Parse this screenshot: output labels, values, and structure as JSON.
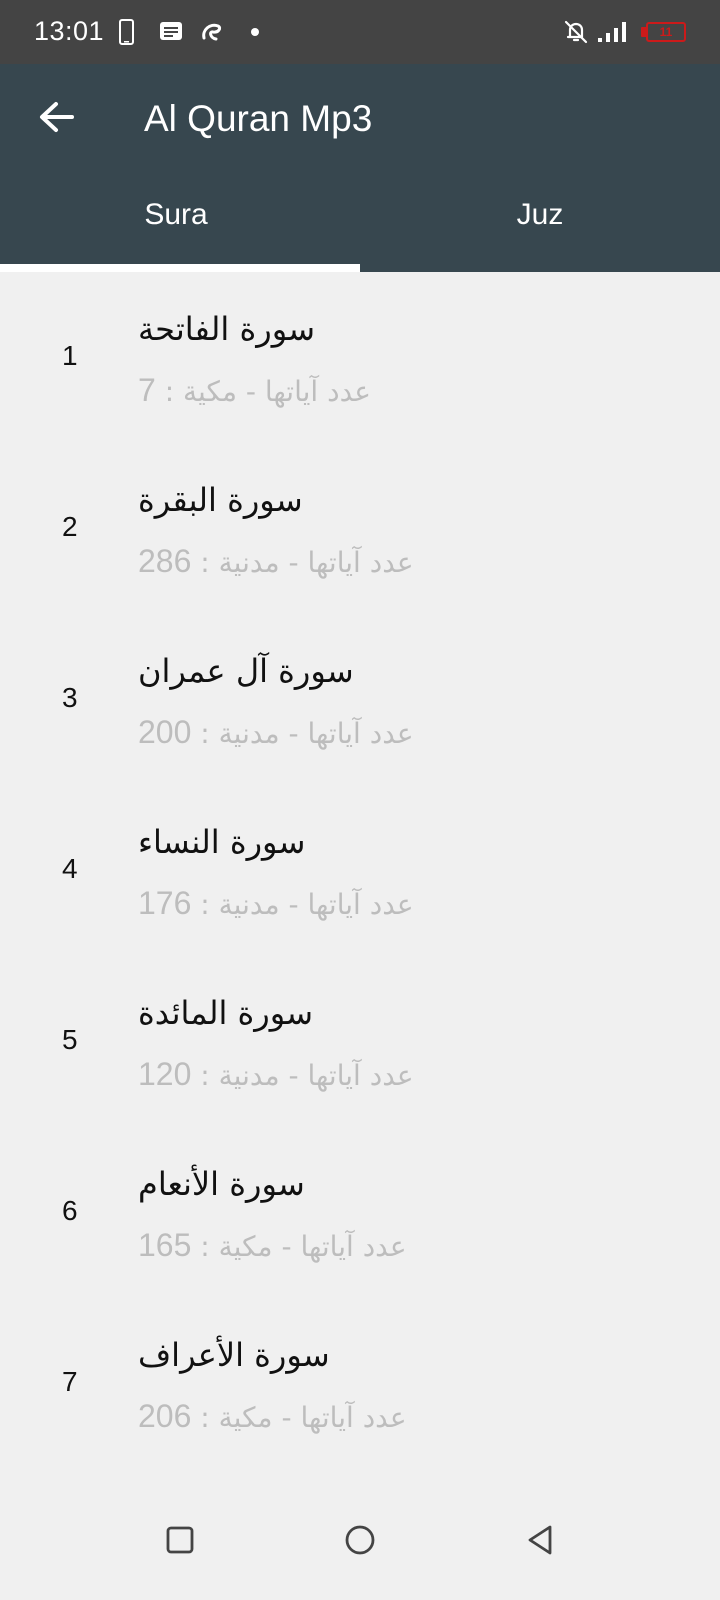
{
  "status_bar": {
    "time": "13:01",
    "battery_label": "11",
    "icons": [
      "phone-outline-icon",
      "message-icon",
      "swirl-app-icon",
      "dot-icon",
      "bell-off-icon",
      "signal-icon",
      "battery-low-icon"
    ],
    "battery_color": "#cc1a1a"
  },
  "app_bar": {
    "title": "Al Quran Mp3",
    "back_icon": "arrow-back-icon",
    "background_color": "#37474f"
  },
  "tabs": [
    {
      "label": "Sura",
      "selected": true
    },
    {
      "label": "Juz",
      "selected": false
    }
  ],
  "suras": [
    {
      "number": "1",
      "name": "سورة الفاتحة",
      "type": "مكية",
      "count_label": "عدد آياتها",
      "count": "7"
    },
    {
      "number": "2",
      "name": "سورة البقرة",
      "type": "مدنية",
      "count_label": "عدد آياتها",
      "count": "286"
    },
    {
      "number": "3",
      "name": "سورة آل عمران",
      "type": "مدنية",
      "count_label": "عدد آياتها",
      "count": "200"
    },
    {
      "number": "4",
      "name": "سورة النساء",
      "type": "مدنية",
      "count_label": "عدد آياتها",
      "count": "176"
    },
    {
      "number": "5",
      "name": "سورة المائدة",
      "type": "مدنية",
      "count_label": "عدد آياتها",
      "count": "120"
    },
    {
      "number": "6",
      "name": "سورة الأنعام",
      "type": "مكية",
      "count_label": "عدد آياتها",
      "count": "165"
    },
    {
      "number": "7",
      "name": "سورة الأعراف",
      "type": "مكية",
      "count_label": "عدد آياتها",
      "count": "206"
    }
  ],
  "nav_bar": {
    "icons": [
      "recents-square-icon",
      "home-circle-icon",
      "back-triangle-icon"
    ]
  }
}
